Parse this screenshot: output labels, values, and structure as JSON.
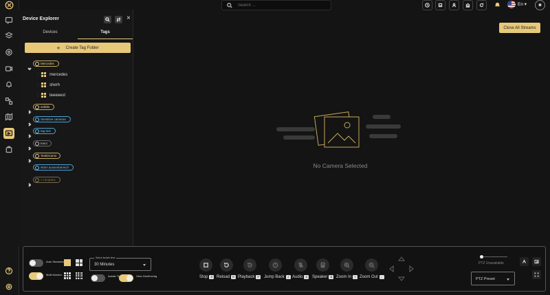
{
  "topbar": {
    "search_placeholder": "Search ...",
    "language": "En"
  },
  "sidebar": {
    "title": "Device Explorer",
    "tabs": [
      {
        "label": "Devices",
        "active": false
      },
      {
        "label": "Tags",
        "active": true
      }
    ],
    "create_label": "Create Tag Folder",
    "tree": {
      "expanded_tag": "Mercedes",
      "devices": [
        "mercedes",
        "sherh",
        "teeeeest"
      ],
      "tags": [
        "safdds",
        "Sensitive cameras",
        "tag test",
        "tear1",
        "TestDCams",
        "WSH aussenbereich",
        "z company"
      ]
    }
  },
  "main": {
    "close_all_label": "Close All Streams",
    "empty_message": "No Camera Selected"
  },
  "bottom": {
    "auto_streaming_label": "Auto Streaming",
    "multi_monitor_label": "Multi Monitor",
    "isolate_time_label": "Isolate Time",
    "view_geofencing_label": "View Geofencing",
    "isolate_select_caption": "Select isolate time",
    "isolate_select_value": "30 Minutes",
    "controls": [
      {
        "label": "Stop",
        "key": "S"
      },
      {
        "label": "Reload",
        "key": "R"
      },
      {
        "label": "Playback",
        "key": "P"
      },
      {
        "label": "Jump Back",
        "key": "J"
      },
      {
        "label": "Audio",
        "key": "A"
      },
      {
        "label": "Speaker",
        "key": "B"
      },
      {
        "label": "Zoom In",
        "key": "+"
      },
      {
        "label": "Zoom Out",
        "key": "-"
      }
    ],
    "ptz_status": "PTZ Unavailable",
    "ptz_preset_label": "PTZ Preset",
    "ptz_slider_value": 0
  },
  "colors": {
    "accent": "#e8c97a",
    "tag_blue": "#4aa3d8"
  }
}
